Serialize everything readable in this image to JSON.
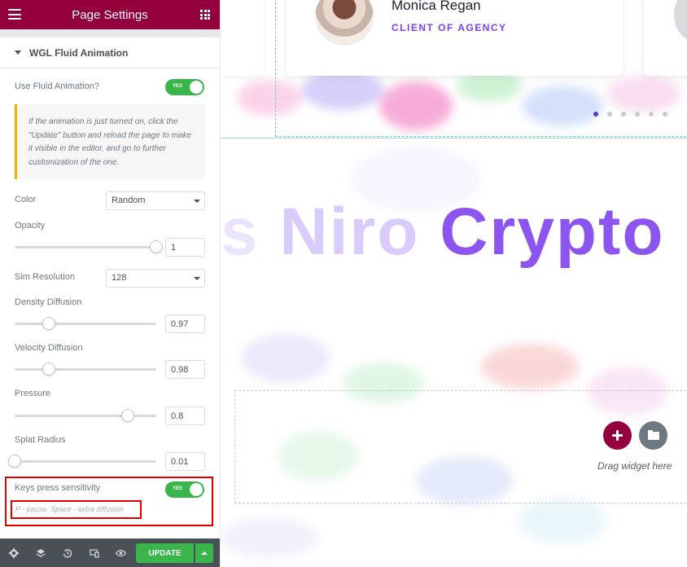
{
  "panel": {
    "header_title": "Page Settings",
    "section_title": "WGL Fluid Animation",
    "use_fluid": {
      "label": "Use Fluid Animation?",
      "toggle_text": "YES",
      "enabled": true
    },
    "note": "If the animation is just turned on, click the \"Update\" button and reload the page to make it visible in the editor, and go to further customization of the one.",
    "color": {
      "label": "Color",
      "value": "Random"
    },
    "opacity": {
      "label": "Opacity",
      "value": "1",
      "level": 1.0
    },
    "sim_resolution": {
      "label": "Sim Resolution",
      "value": "128"
    },
    "density_diffusion": {
      "label": "Density Diffusion",
      "value": "0.97",
      "level": 0.24
    },
    "velocity_diffusion": {
      "label": "Velocity Diffusion",
      "value": "0.98",
      "level": 0.24
    },
    "pressure": {
      "label": "Pressure",
      "value": "0.8",
      "level": 0.8
    },
    "splat_radius": {
      "label": "Splat Radius",
      "value": "0.01",
      "level": 0.0
    },
    "keys_press": {
      "label": "Keys press sensitivity",
      "toggle_text": "YES",
      "enabled": true,
      "hint": "P - pause. Space - extra diffusion"
    },
    "footer": {
      "update_label": "UPDATE"
    }
  },
  "preview": {
    "testimonial": {
      "name": "Monica Regan",
      "role": "CLIENT OF AGENCY"
    },
    "slider_dots": {
      "count": 6,
      "active": 0
    },
    "headline": {
      "part1": "s ",
      "part2": "Niro ",
      "part3": "Crypto"
    },
    "drop_area_text": "Drag widget here"
  },
  "colors": {
    "brand": "#93003c",
    "toggle_on": "#39b54a",
    "accent_purple": "#7a3ff2",
    "highlight": "#e00000"
  }
}
